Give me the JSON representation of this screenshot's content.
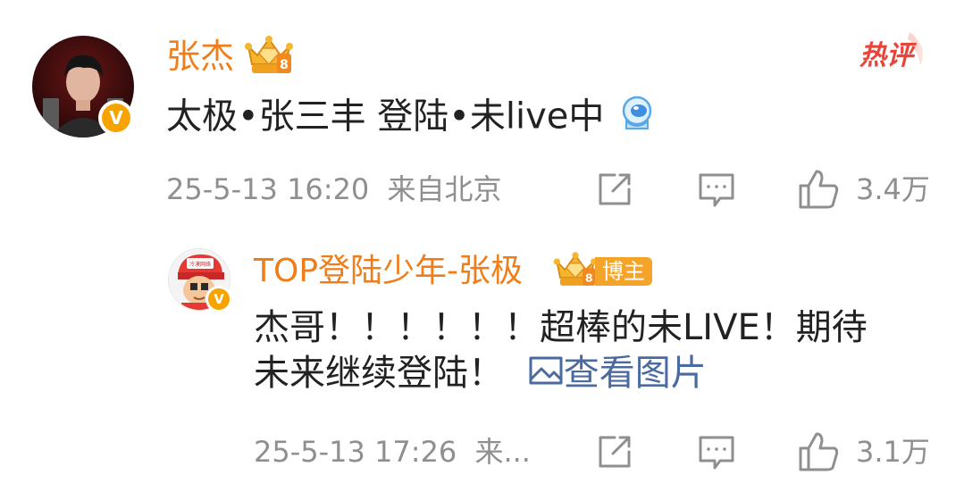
{
  "main_comment": {
    "username": "张杰",
    "text": "太极•张三丰 登陆•未live中",
    "timestamp": "25-5-13 16:20",
    "location": "来自北京",
    "likes": "3.4万",
    "hot_label": "热评",
    "crown_level": "8",
    "verified_mark": "V"
  },
  "reply": {
    "username": "TOP登陆少年-张极",
    "blogger_tag": "博主",
    "text_line1": "杰哥！！！！！！超棒的未LIVE！期待",
    "text_line2": "未来继续登陆！",
    "view_image_label": "查看图片",
    "timestamp": "25-5-13 17:26",
    "location": "来...",
    "likes": "3.1万",
    "crown_level": "8",
    "verified_mark": "V",
    "cap_text": "冷漠网络"
  },
  "colors": {
    "username": "#ef7e1a",
    "meta": "#8f8f8f",
    "link": "#4a6aa0",
    "hot": "#e8443a",
    "verified": "#f7a400",
    "blogger_tag_bg": "#f5a42a"
  }
}
